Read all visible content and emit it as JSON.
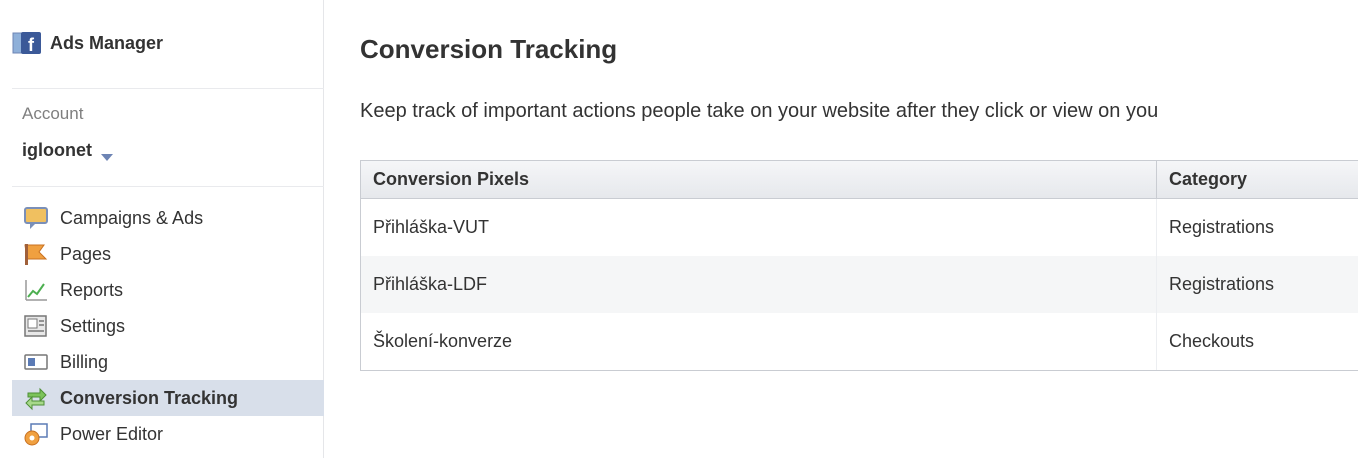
{
  "sidebar": {
    "brand": {
      "icon": "facebook-ads-icon",
      "label": "Ads Manager"
    },
    "account": {
      "label": "Account",
      "value": "igloonet"
    },
    "nav": [
      {
        "icon": "speech-bubble-icon",
        "label": "Campaigns & Ads",
        "active": false
      },
      {
        "icon": "flag-icon",
        "label": "Pages",
        "active": false
      },
      {
        "icon": "chart-icon",
        "label": "Reports",
        "active": false
      },
      {
        "icon": "settings-icon",
        "label": "Settings",
        "active": false
      },
      {
        "icon": "credit-card-icon",
        "label": "Billing",
        "active": false
      },
      {
        "icon": "conversion-arrows-icon",
        "label": "Conversion Tracking",
        "active": true
      },
      {
        "icon": "power-editor-icon",
        "label": "Power Editor",
        "active": false
      }
    ]
  },
  "main": {
    "title": "Conversion Tracking",
    "description": "Keep track of important actions people take on your website after they click or view on you",
    "table": {
      "headers": [
        "Conversion Pixels",
        "Category"
      ],
      "rows": [
        [
          "Přihláška-VUT",
          "Registrations"
        ],
        [
          "Přihláška-LDF",
          "Registrations"
        ],
        [
          "Školení-konverze",
          "Checkouts"
        ]
      ]
    }
  },
  "colors": {
    "active_nav_bg": "#d8dfea",
    "table_border": "#c9ccd2",
    "facebook_blue": "#3b5998",
    "caret": "#6d84b4"
  }
}
